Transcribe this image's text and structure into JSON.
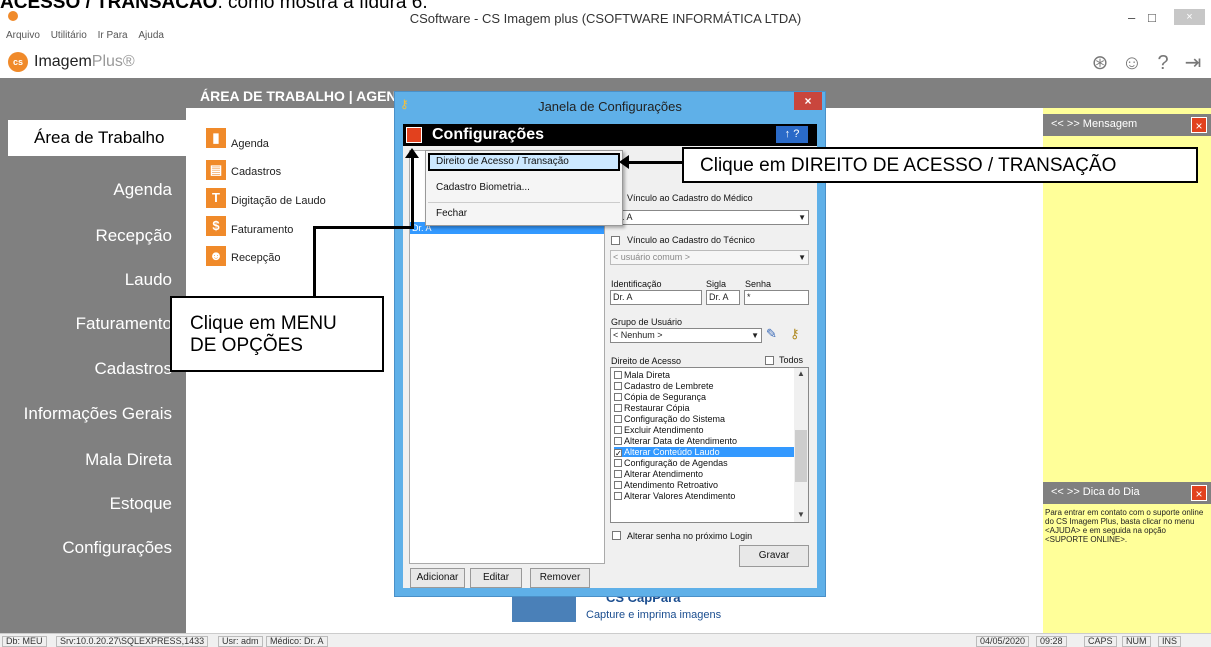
{
  "caption": {
    "bold": "ACESSO / TRANSAÇÃO",
    "rest": ", como mostra a figura 6."
  },
  "window": {
    "title": "CSoftware - CS Imagem plus (CSOFTWARE INFORMÁTICA LTDA)",
    "min": "–",
    "max": "□",
    "close": "×"
  },
  "menubar": [
    "Arquivo",
    "Utilitário",
    "Ir Para",
    "Ajuda"
  ],
  "logo": {
    "mark": "cs",
    "name": "Imagem",
    "suffix": "Plus®"
  },
  "header": {
    "text": "ÁREA DE TRABALHO  |  AGENDA"
  },
  "nav": {
    "active": "Área de Trabalho",
    "items": [
      "Agenda",
      "Recepção",
      "Laudo",
      "Faturamento",
      "Cadastros",
      "Informações Gerais",
      "Mala Direta",
      "Estoque",
      "Configurações"
    ]
  },
  "modules": [
    {
      "label": "Agenda",
      "glyph": "▮"
    },
    {
      "label": "Cadastros",
      "glyph": "▤"
    },
    {
      "label": "Digitação de Laudo",
      "glyph": "T"
    },
    {
      "label": "Faturamento",
      "glyph": "$"
    },
    {
      "label": "Recepção",
      "glyph": "☻"
    }
  ],
  "right_panel": {
    "message_head": "<<  >> Mensagem",
    "tip_head": "<<  >> Dica do Dia",
    "tip_text": "Para entrar em contato com o suporte online do CS Imagem Plus, basta clicar no menu <AJUDA> e em seguida na opção <SUPORTE ONLINE>.",
    "close": "×"
  },
  "promo": {
    "title": "CS CapPara",
    "subtitle": "Capture e imprima imagens"
  },
  "dialog": {
    "title": "Janela de Configurações",
    "close": "×",
    "panel_title": "Configurações",
    "panel_buttons": "↑ ?",
    "selected_user": "Dr. A",
    "menu": [
      "Direito de Acesso / Transação",
      "Cadastro Biometria...",
      "Fechar"
    ],
    "form": {
      "vinc_medico_label": "Vínculo ao Cadastro do Médico",
      "vinc_medico_value": "Dr. A",
      "vinc_tecnico_label": "Vínculo ao Cadastro do Técnico",
      "vinc_tecnico_value": "< usuário comum >",
      "ident_label": "Identificação",
      "ident_value": "Dr. A",
      "sigla_label": "Sigla",
      "sigla_value": "Dr. A",
      "senha_label": "Senha",
      "senha_value": "*",
      "grupo_label": "Grupo de Usuário",
      "grupo_value": "< Nenhum >",
      "direito_label": "Direito de Acesso",
      "todos_label": "Todos",
      "permissions": [
        {
          "label": "Mala Direta",
          "checked": false
        },
        {
          "label": "Cadastro de Lembrete",
          "checked": false
        },
        {
          "label": "Cópia de Segurança",
          "checked": false
        },
        {
          "label": "Restaurar Cópia",
          "checked": false
        },
        {
          "label": "Configuração do Sistema",
          "checked": false
        },
        {
          "label": "Excluir Atendimento",
          "checked": false
        },
        {
          "label": "Alterar Data de Atendimento",
          "checked": false
        },
        {
          "label": "Alterar Conteúdo Laudo",
          "checked": true
        },
        {
          "label": "Configuração de Agendas",
          "checked": false
        },
        {
          "label": "Alterar Atendimento",
          "checked": false
        },
        {
          "label": "Atendimento Retroativo",
          "checked": false
        },
        {
          "label": "Alterar Valores Atendimento",
          "checked": false
        }
      ],
      "alterar_senha_label": "Alterar senha no próximo Login"
    },
    "buttons": {
      "adicionar": "Adicionar",
      "editar": "Editar",
      "remover": "Remover",
      "gravar": "Gravar"
    }
  },
  "callouts": {
    "direito": "Clique em DIREITO DE ACESSO / TRANSAÇÃO",
    "menu_line1": "Clique em MENU",
    "menu_line2": "DE OPÇÕES"
  },
  "statusbar": {
    "db": "Db: MEU",
    "srv": "Srv:10.0.20.27\\SQLEXPRESS,1433",
    "usr": "Usr: adm",
    "medico": "Médico: Dr. A",
    "date": "04/05/2020",
    "time": "09:28",
    "caps": "CAPS",
    "num": "NUM",
    "ins": "INS"
  }
}
